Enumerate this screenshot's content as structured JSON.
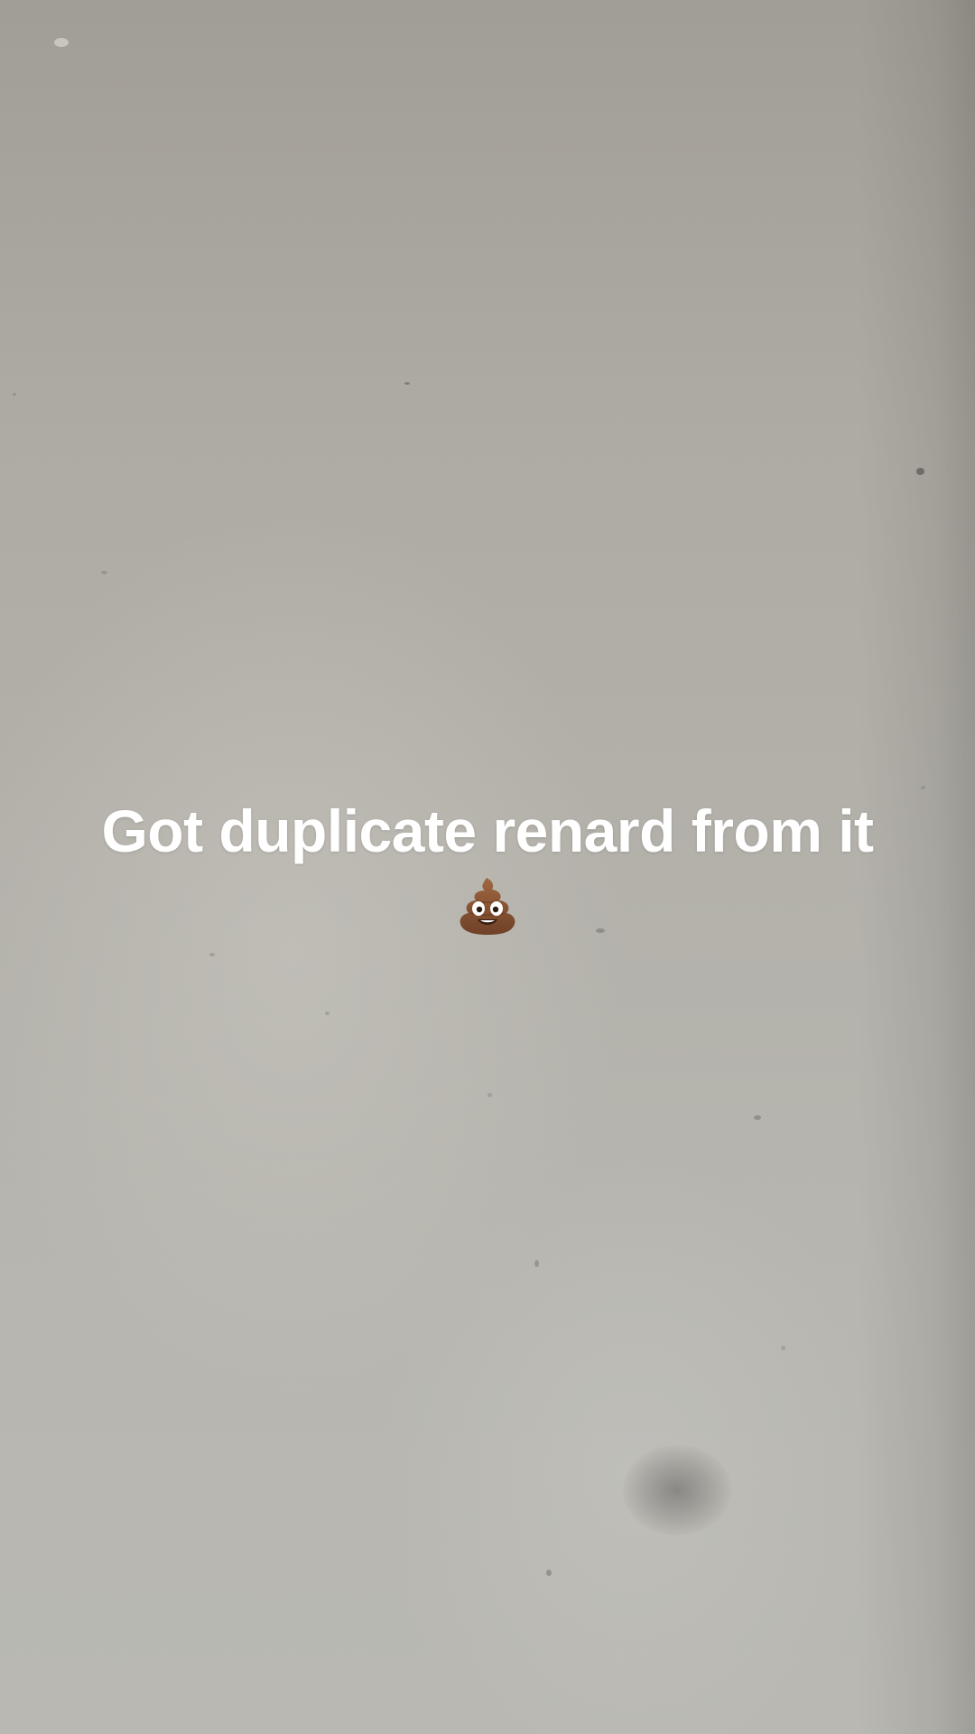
{
  "caption": {
    "text": "Got duplicate renard from it",
    "emoji": "pile-of-poo"
  },
  "colors": {
    "wall": "#b3b1aa",
    "caption_text": "#ffffff",
    "emoji_brown": "#8a5a3a"
  }
}
